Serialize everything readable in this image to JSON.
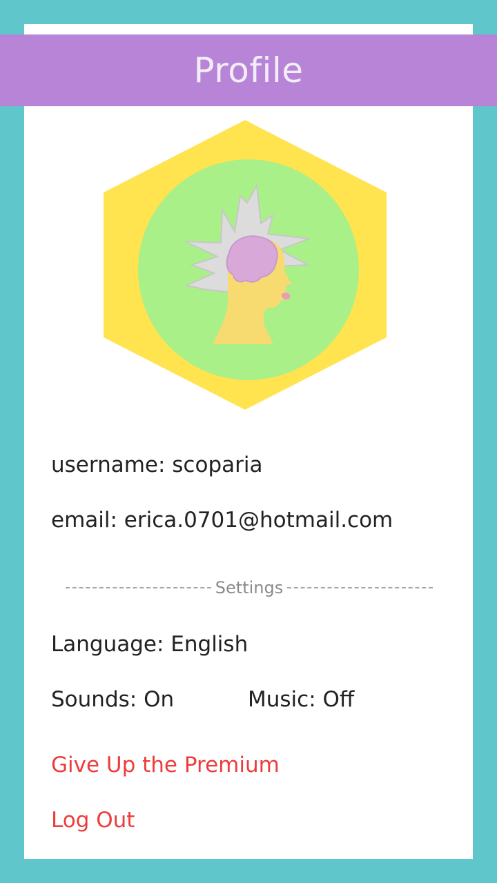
{
  "header": {
    "title": "Profile"
  },
  "avatar": {
    "icon": "brain-head-icon",
    "hex_color": "#ffe34f",
    "circle_color": "#aaf089"
  },
  "profile": {
    "username": "username: scoparia",
    "email": "email: erica.0701@hotmail.com"
  },
  "settings": {
    "divider_label": "Settings",
    "language": "Language: English",
    "sounds": "Sounds: On",
    "music": "Music: Off"
  },
  "actions": {
    "give_up_premium": "Give Up the Premium",
    "log_out": "Log Out"
  },
  "colors": {
    "background": "#5fc6cc",
    "header": "#b784d8",
    "action_text": "#ee3b3b"
  }
}
